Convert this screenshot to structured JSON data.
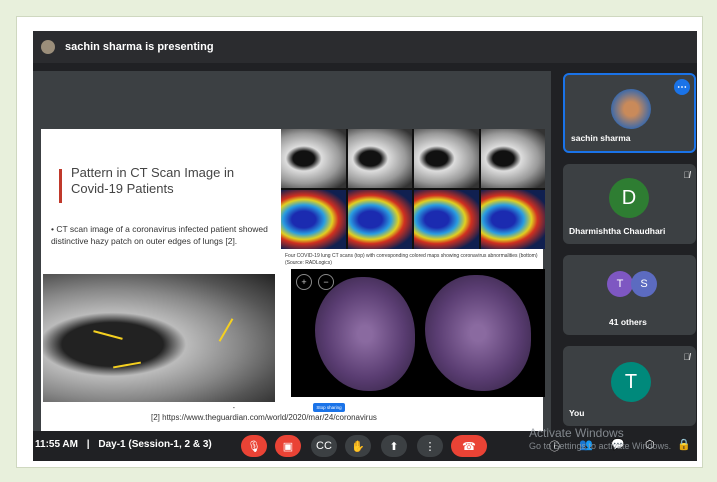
{
  "presenter": {
    "text": "sachin sharma is presenting"
  },
  "slide": {
    "title": "Pattern in CT Scan Image in Covid-19 Patients",
    "bullet": "CT scan image of a coronavirus infected patient showed distinctive hazy patch on outer edges of lungs [2].",
    "caption_top": "Four COVID-19 lung CT scans (top) with corresponding colored maps showing coronavirus abnormalities (bottom) (Source: RADLogics)",
    "reference": "[2] https://www.theguardian.com/world/2020/mar/24/coronavirus",
    "stop_sharing": "Stop sharing"
  },
  "participants": [
    {
      "name": "sachin sharma",
      "initial": "",
      "color": "#8a7a66"
    },
    {
      "name": "Dharmishtha Chaudhari",
      "initial": "D",
      "color": "#2e7d32"
    },
    {
      "name": "41 others",
      "initials": [
        "T",
        "S"
      ],
      "colors": [
        "#7e57c2",
        "#5c6bc0"
      ]
    },
    {
      "name": "You",
      "initial": "T",
      "color": "#00897b"
    }
  ],
  "bottom": {
    "time": "11:55 AM",
    "separator": "|",
    "meeting": "Day-1 (Session-1, 2 & 3)"
  },
  "watermark": {
    "line1": "Activate Windows",
    "line2": "Go to Settings to activate Windows."
  },
  "icons": {
    "mic_off": "mic-off-icon",
    "cam_off": "camera-off-icon",
    "captions": "captions-icon",
    "hand": "raise-hand-icon",
    "present": "present-icon",
    "more": "more-vert-icon",
    "end": "call-end-icon",
    "info": "info-icon",
    "people": "people-icon",
    "chat": "chat-icon",
    "activities": "activities-icon",
    "lock": "lock-icon"
  },
  "colors": {
    "red": "#ea4335",
    "blue": "#1a73e8",
    "dark": "#202124"
  }
}
